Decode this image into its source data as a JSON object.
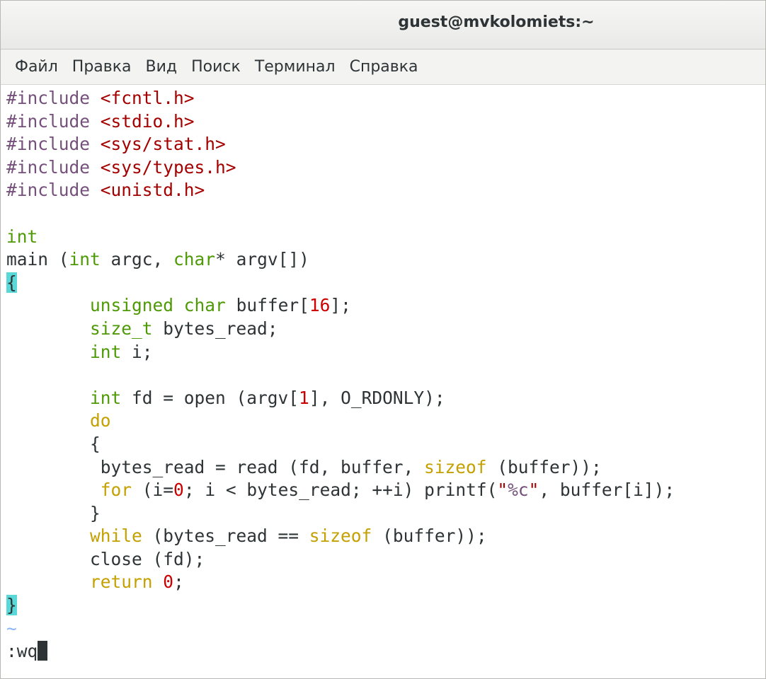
{
  "window": {
    "title": "guest@mvkolomiets:~"
  },
  "menu": {
    "items": [
      "Файл",
      "Правка",
      "Вид",
      "Поиск",
      "Терминал",
      "Справка"
    ]
  },
  "editor": {
    "lines": [
      {
        "tokens": [
          {
            "t": "#include ",
            "c": "pre"
          },
          {
            "t": "<fcntl.h>",
            "c": "str"
          }
        ]
      },
      {
        "tokens": [
          {
            "t": "#include ",
            "c": "pre"
          },
          {
            "t": "<stdio.h>",
            "c": "str"
          }
        ]
      },
      {
        "tokens": [
          {
            "t": "#include ",
            "c": "pre"
          },
          {
            "t": "<sys/stat.h>",
            "c": "str"
          }
        ]
      },
      {
        "tokens": [
          {
            "t": "#include ",
            "c": "pre"
          },
          {
            "t": "<sys/types.h>",
            "c": "str"
          }
        ]
      },
      {
        "tokens": [
          {
            "t": "#include ",
            "c": "pre"
          },
          {
            "t": "<unistd.h>",
            "c": "str"
          }
        ]
      },
      {
        "tokens": []
      },
      {
        "tokens": [
          {
            "t": "int",
            "c": "type"
          }
        ]
      },
      {
        "tokens": [
          {
            "t": "main (",
            "c": "norm"
          },
          {
            "t": "int",
            "c": "type"
          },
          {
            "t": " argc, ",
            "c": "norm"
          },
          {
            "t": "char",
            "c": "type"
          },
          {
            "t": "* argv[])",
            "c": "norm"
          }
        ]
      },
      {
        "tokens": [
          {
            "t": "{",
            "c": "bracket"
          }
        ]
      },
      {
        "tokens": [
          {
            "t": "        ",
            "c": "norm"
          },
          {
            "t": "unsigned",
            "c": "type"
          },
          {
            "t": " ",
            "c": "norm"
          },
          {
            "t": "char",
            "c": "type"
          },
          {
            "t": " buffer[",
            "c": "norm"
          },
          {
            "t": "16",
            "c": "num"
          },
          {
            "t": "];",
            "c": "norm"
          }
        ]
      },
      {
        "tokens": [
          {
            "t": "        ",
            "c": "norm"
          },
          {
            "t": "size_t",
            "c": "type"
          },
          {
            "t": " bytes_read;",
            "c": "norm"
          }
        ]
      },
      {
        "tokens": [
          {
            "t": "        ",
            "c": "norm"
          },
          {
            "t": "int",
            "c": "type"
          },
          {
            "t": " i;",
            "c": "norm"
          }
        ]
      },
      {
        "tokens": []
      },
      {
        "tokens": [
          {
            "t": "        ",
            "c": "norm"
          },
          {
            "t": "int",
            "c": "type"
          },
          {
            "t": " fd = open (argv[",
            "c": "norm"
          },
          {
            "t": "1",
            "c": "num"
          },
          {
            "t": "], O_RDONLY);",
            "c": "norm"
          }
        ]
      },
      {
        "tokens": [
          {
            "t": "        ",
            "c": "norm"
          },
          {
            "t": "do",
            "c": "kw"
          }
        ]
      },
      {
        "tokens": [
          {
            "t": "        {",
            "c": "norm"
          }
        ]
      },
      {
        "tokens": [
          {
            "t": "         bytes_read = read (fd, buffer, ",
            "c": "norm"
          },
          {
            "t": "sizeof",
            "c": "kw"
          },
          {
            "t": " (buffer));",
            "c": "norm"
          }
        ]
      },
      {
        "tokens": [
          {
            "t": "         ",
            "c": "norm"
          },
          {
            "t": "for",
            "c": "kw"
          },
          {
            "t": " (i=",
            "c": "norm"
          },
          {
            "t": "0",
            "c": "num"
          },
          {
            "t": "; i < bytes_read; ++i) printf(",
            "c": "norm"
          },
          {
            "t": "\"",
            "c": "str"
          },
          {
            "t": "%c",
            "c": "pre"
          },
          {
            "t": "\"",
            "c": "str"
          },
          {
            "t": ", buffer[i]);",
            "c": "norm"
          }
        ]
      },
      {
        "tokens": [
          {
            "t": "        }",
            "c": "norm"
          }
        ]
      },
      {
        "tokens": [
          {
            "t": "        ",
            "c": "norm"
          },
          {
            "t": "while",
            "c": "kw"
          },
          {
            "t": " (bytes_read == ",
            "c": "norm"
          },
          {
            "t": "sizeof",
            "c": "kw"
          },
          {
            "t": " (buffer));",
            "c": "norm"
          }
        ]
      },
      {
        "tokens": [
          {
            "t": "        close (fd);",
            "c": "norm"
          }
        ]
      },
      {
        "tokens": [
          {
            "t": "        ",
            "c": "norm"
          },
          {
            "t": "return",
            "c": "kw"
          },
          {
            "t": " ",
            "c": "norm"
          },
          {
            "t": "0",
            "c": "num"
          },
          {
            "t": ";",
            "c": "norm"
          }
        ]
      },
      {
        "tokens": [
          {
            "t": "}",
            "c": "bracket"
          }
        ]
      },
      {
        "tokens": [
          {
            "t": "~",
            "c": "tilde"
          }
        ]
      }
    ],
    "command_line": ":wq"
  },
  "colors": {
    "preprocessor": "#75507b",
    "string": "#a40000",
    "type": "#4e9a06",
    "keyword": "#c4a000",
    "number": "#cc0000",
    "bracket_highlight": "#5ad7d7"
  }
}
